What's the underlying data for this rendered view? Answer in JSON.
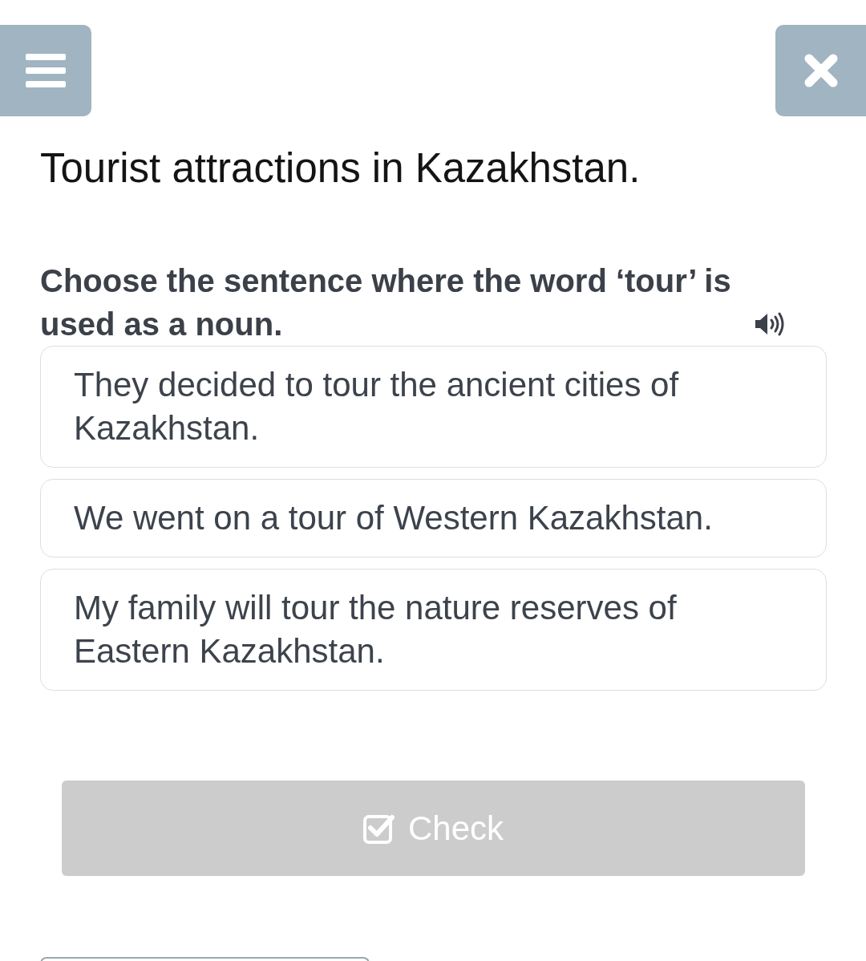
{
  "title": "Tourist attractions in Kazakhstan.",
  "question": {
    "text": "Choose the sentence where the word ‘tour’ is used as a noun.",
    "audio": true
  },
  "options": [
    {
      "text": "They decided to tour the ancient cities of Kazakhstan.",
      "selected": false
    },
    {
      "text": "We went on a tour of Western Kazakhstan.",
      "selected": false
    },
    {
      "text": "My family will tour the nature reserves of Eastern Kazakhstan.",
      "selected": false
    }
  ],
  "check_button": {
    "label": "Check",
    "disabled": true
  }
}
